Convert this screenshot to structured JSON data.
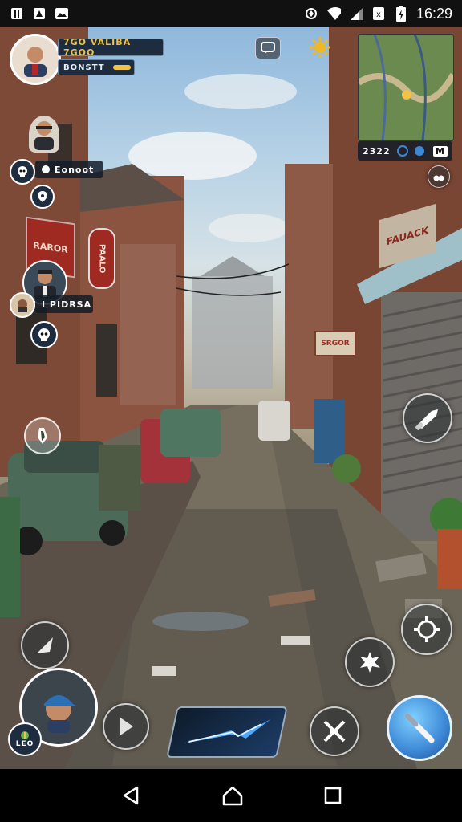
{
  "status_bar": {
    "time": "16:29",
    "left_icons": [
      "notification-icon",
      "image-icon",
      "gallery-icon"
    ],
    "right_icons": [
      "vibrate-icon",
      "wifi-icon",
      "signal-icon",
      "no-sim-icon",
      "battery-icon"
    ]
  },
  "hud": {
    "player_stat_line1": "7GO VALIBA 7GOO",
    "player_stat_line2": "BONSTT",
    "minimap_coords": "2322",
    "minimap_label": "M",
    "npc1_label": "Eonoot",
    "npc2_label": "I PIDRSA",
    "player_level": "LEO"
  },
  "scene_signs": {
    "left_sign": "RAROR",
    "tall_sign_left": "PAALO",
    "right_shop": "FAUACK",
    "shop_sign2": "SRGOR"
  },
  "colors": {
    "stat_accent": "#f0c24a",
    "hud_panel": "#1d2d3f",
    "action_blue": "#3d88d6",
    "sign_red": "#9e2a22"
  }
}
